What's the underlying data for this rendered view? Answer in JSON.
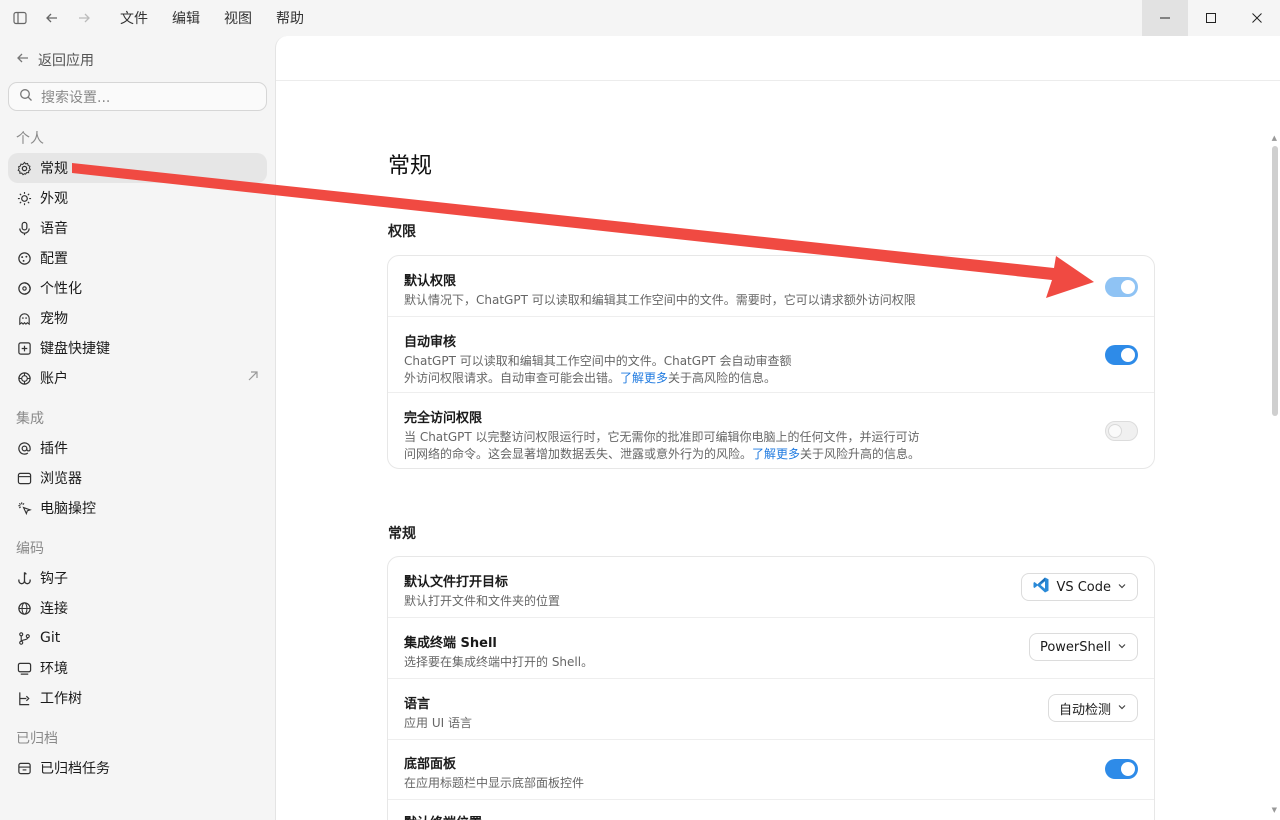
{
  "titlebar": {
    "menu": [
      "文件",
      "编辑",
      "视图",
      "帮助"
    ]
  },
  "sidebar": {
    "back_label": "返回应用",
    "search_placeholder": "搜索设置...",
    "sections": [
      {
        "title": "个人",
        "items": [
          {
            "label": "常规",
            "icon": "gear-icon",
            "active": true
          },
          {
            "label": "外观",
            "icon": "sun-icon"
          },
          {
            "label": "语音",
            "icon": "microphone-icon"
          },
          {
            "label": "配置",
            "icon": "sliders-icon"
          },
          {
            "label": "个性化",
            "icon": "personalize-icon"
          },
          {
            "label": "宠物",
            "icon": "pet-icon"
          },
          {
            "label": "键盘快捷键",
            "icon": "keyboard-icon"
          },
          {
            "label": "账户",
            "icon": "account-icon",
            "external": true
          }
        ]
      },
      {
        "title": "集成",
        "items": [
          {
            "label": "插件",
            "icon": "at-icon"
          },
          {
            "label": "浏览器",
            "icon": "browser-icon"
          },
          {
            "label": "电脑操控",
            "icon": "cursor-icon"
          }
        ]
      },
      {
        "title": "编码",
        "items": [
          {
            "label": "钩子",
            "icon": "hook-icon"
          },
          {
            "label": "连接",
            "icon": "globe-icon"
          },
          {
            "label": "Git",
            "icon": "git-icon"
          },
          {
            "label": "环境",
            "icon": "monitor-icon"
          },
          {
            "label": "工作树",
            "icon": "tree-icon"
          }
        ]
      },
      {
        "title": "已归档",
        "items": [
          {
            "label": "已归档任务",
            "icon": "archive-icon"
          }
        ]
      }
    ]
  },
  "main": {
    "title": "常规",
    "permissions": {
      "title": "权限",
      "rows": [
        {
          "title": "默认权限",
          "desc": "默认情况下，ChatGPT 可以读取和编辑其工作空间中的文件。需要时，它可以请求额外访问权限",
          "toggle": "on-dim"
        },
        {
          "title": "自动审核",
          "desc1": "ChatGPT 可以读取和编辑其工作空间中的文件。ChatGPT 会自动审查额",
          "desc2_pre": "外访问权限请求。自动审查可能会出错。",
          "link": "了解更多",
          "desc2_post": "关于高风险的信息。",
          "toggle": "on"
        },
        {
          "title": "完全访问权限",
          "desc1": "当 ChatGPT 以完整访问权限运行时，它无需你的批准即可编辑你电脑上的任何文件，并运行可访",
          "desc2_pre": "问网络的命令。这会显著增加数据丢失、泄露或意外行为的风险。",
          "link": "了解更多",
          "desc2_post": "关于风险升高的信息。",
          "toggle": "off"
        }
      ]
    },
    "general": {
      "title": "常规",
      "rows": [
        {
          "title": "默认文件打开目标",
          "desc": "默认打开文件和文件夹的位置",
          "select": "VS Code"
        },
        {
          "title": "集成终端 Shell",
          "desc": "选择要在集成终端中打开的 Shell。",
          "select": "PowerShell"
        },
        {
          "title": "语言",
          "desc": "应用 UI 语言",
          "select": "自动检测"
        },
        {
          "title": "底部面板",
          "desc": "在应用标题栏中显示底部面板控件",
          "toggle": "on"
        },
        {
          "title": "默认终端位置",
          "desc": ""
        }
      ]
    }
  },
  "colors": {
    "accent": "#2e8be8",
    "annotation_arrow": "#f04a42"
  }
}
